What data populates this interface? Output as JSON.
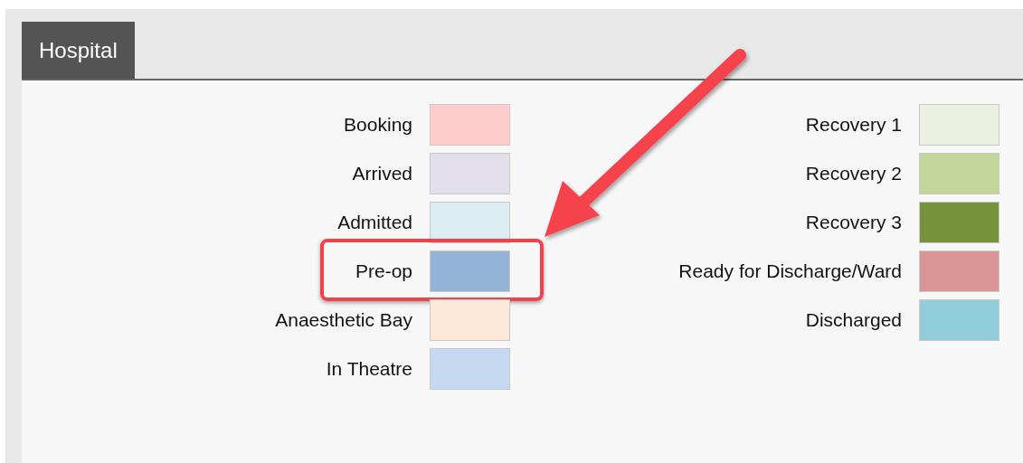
{
  "tabs": [
    {
      "label": "Hospital",
      "selected": true
    }
  ],
  "legend_left": [
    {
      "label": "Booking",
      "color": "#ffcccc",
      "highlighted": false
    },
    {
      "label": "Arrived",
      "color": "#e4dfec",
      "highlighted": false
    },
    {
      "label": "Admitted",
      "color": "#daeef3",
      "highlighted": false
    },
    {
      "label": "Pre-op",
      "color": "#95b3d7",
      "highlighted": true
    },
    {
      "label": "Anaesthetic Bay",
      "color": "#fde9d9",
      "highlighted": false
    },
    {
      "label": "In Theatre",
      "color": "#c5d9f1",
      "highlighted": false
    }
  ],
  "legend_right": [
    {
      "label": "Recovery 1",
      "color": "#ebf1de",
      "highlighted": false
    },
    {
      "label": "Recovery 2",
      "color": "#c4d79b",
      "highlighted": false
    },
    {
      "label": "Recovery 3",
      "color": "#76933c",
      "highlighted": false
    },
    {
      "label": "Ready for Discharge/Ward",
      "color": "#da9694",
      "highlighted": false
    },
    {
      "label": "Discharged",
      "color": "#92cddc",
      "highlighted": false
    }
  ]
}
